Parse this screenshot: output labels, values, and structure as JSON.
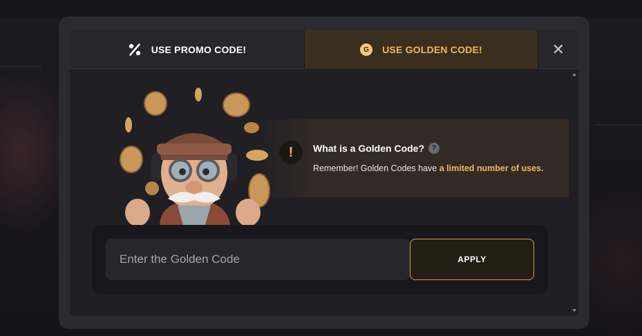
{
  "tabs": {
    "promo_label": "USE PROMO CODE!",
    "golden_label": "USE GOLDEN CODE!",
    "golden_badge": "G",
    "close_symbol": "✕"
  },
  "info": {
    "warning_symbol": "!",
    "title": "What is a Golden Code?",
    "help_symbol": "?",
    "text_prefix": "Remember! Golden Codes have ",
    "text_highlight": "a limited number of uses."
  },
  "form": {
    "input_placeholder": "Enter the Golden Code",
    "input_value": "",
    "apply_label": "APPLY"
  },
  "icons": {
    "promo_tab_icon": "percent-icon",
    "golden_tab_icon": "gold-coin-icon",
    "close_icon": "close-icon",
    "warning_icon": "exclamation-icon",
    "help_icon": "question-icon",
    "mascot": "pilot-mascot-with-coins"
  },
  "colors": {
    "accent_gold": "#f2b660",
    "active_tab_bg": "#3a2e1e",
    "modal_bg": "#1f1f24",
    "apply_border": "#c9a15a"
  }
}
